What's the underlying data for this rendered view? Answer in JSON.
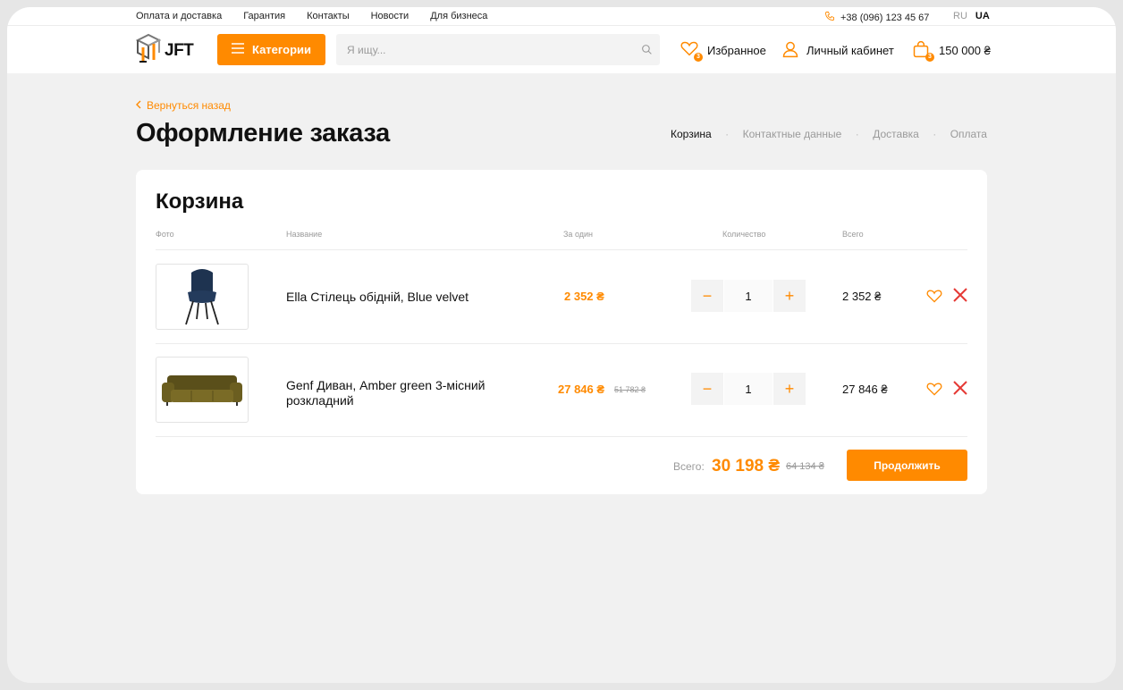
{
  "topbar": {
    "links": [
      "Оплата и доставка",
      "Гарантия",
      "Контакты",
      "Новости",
      "Для бизнеса"
    ],
    "phone": "+38 (096) 123 45 67",
    "lang_ru": "RU",
    "lang_ua": "UA"
  },
  "header": {
    "logo_text": "JFT",
    "categories_label": "Категории",
    "search_placeholder": "Я ищу...",
    "favorites_label": "Избранное",
    "favorites_count": "3",
    "account_label": "Личный кабинет",
    "cart_total": "150 000 ₴",
    "cart_count": "3"
  },
  "page": {
    "back_label": "Вернуться назад",
    "title": "Оформление заказа",
    "steps": [
      "Корзина",
      "Контактные данные",
      "Доставка",
      "Оплата"
    ],
    "active_step": "Корзина"
  },
  "cart": {
    "title": "Корзина",
    "columns": {
      "photo": "Фото",
      "name": "Название",
      "unit": "За один",
      "qty": "Количество",
      "total": "Всего"
    },
    "items": [
      {
        "name": "Ella Стілець обідній, Blue velvet",
        "price": "2 352 ₴",
        "old_price": "",
        "qty": "1",
        "total": "2 352 ₴",
        "image": "chair"
      },
      {
        "name": "Genf Диван, Amber green 3-місний розкладний",
        "price": "27 846 ₴",
        "old_price": "51 782 ₴",
        "qty": "1",
        "total": "27 846 ₴",
        "image": "sofa"
      }
    ],
    "total_label": "Всего:",
    "total_value": "30 198 ₴",
    "total_old": "64 134 ₴",
    "continue_label": "Продолжить"
  },
  "colors": {
    "accent": "#ff8a00",
    "background": "#f1f1f1",
    "card": "#ffffff",
    "remove": "#e53935"
  }
}
